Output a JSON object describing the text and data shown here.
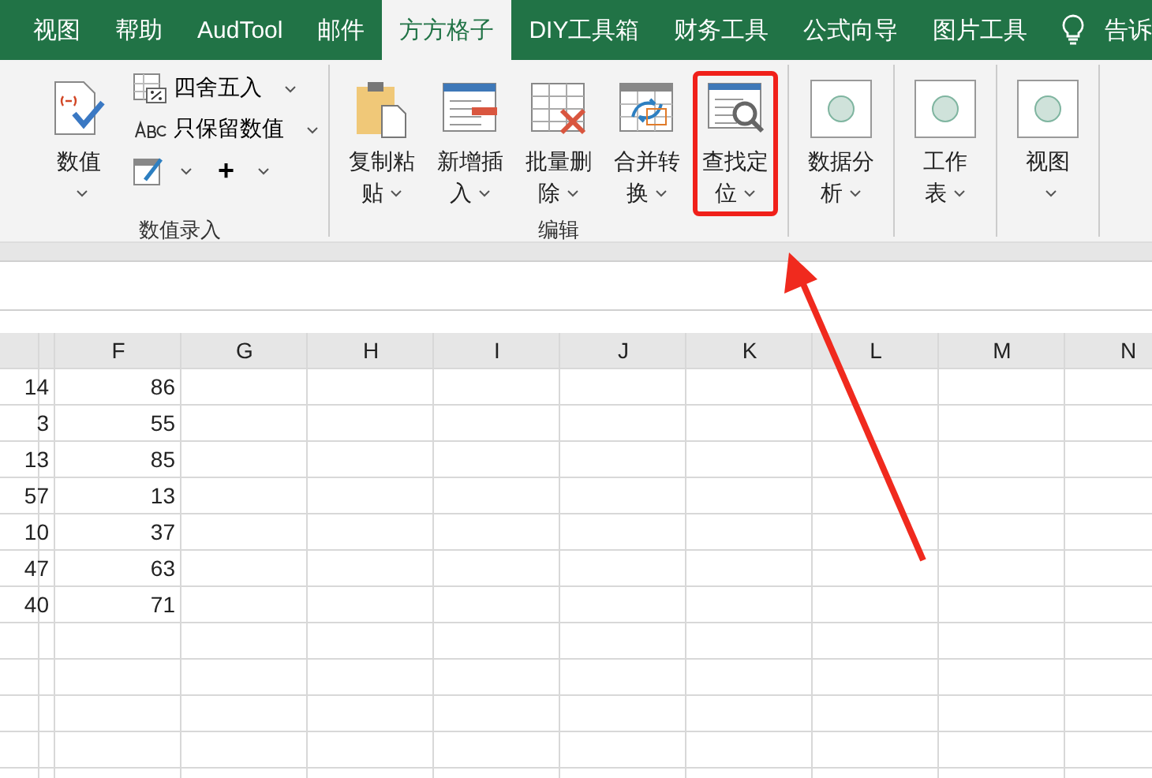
{
  "tabs": [
    {
      "label": "视图",
      "selected": false
    },
    {
      "label": "帮助",
      "selected": false
    },
    {
      "label": "AudTool",
      "selected": false
    },
    {
      "label": "邮件",
      "selected": false
    },
    {
      "label": "方方格子",
      "selected": true
    },
    {
      "label": "DIY工具箱",
      "selected": false
    },
    {
      "label": "财务工具",
      "selected": false
    },
    {
      "label": "公式向导",
      "selected": false
    },
    {
      "label": "图片工具",
      "selected": false
    }
  ],
  "tell_me": "告诉",
  "ribbon": {
    "groups": [
      {
        "label": "数值录入",
        "big_buttons": [
          {
            "kind": "number",
            "lines": [
              "数值"
            ],
            "highlighted": false
          }
        ],
        "small_buttons": [
          {
            "kind": "round",
            "label": "四舍五入"
          },
          {
            "kind": "keep",
            "label": "只保留数值"
          },
          {
            "kind": "tools",
            "label": "+"
          }
        ]
      },
      {
        "label": "编辑",
        "big_buttons": [
          {
            "kind": "paste",
            "lines": [
              "复制粘",
              "贴"
            ],
            "highlighted": false
          },
          {
            "kind": "insert",
            "lines": [
              "新增插",
              "入"
            ],
            "highlighted": false
          },
          {
            "kind": "delete",
            "lines": [
              "批量删",
              "除"
            ],
            "highlighted": false
          },
          {
            "kind": "merge",
            "lines": [
              "合并转",
              "换"
            ],
            "highlighted": false
          },
          {
            "kind": "find",
            "lines": [
              "查找定",
              "位"
            ],
            "highlighted": true
          }
        ]
      },
      {
        "big_buttons": [
          {
            "kind": "circle",
            "lines": [
              "数据分",
              "析"
            ],
            "highlighted": false
          }
        ]
      },
      {
        "big_buttons": [
          {
            "kind": "circle",
            "lines": [
              "工作",
              "表"
            ],
            "highlighted": false
          }
        ]
      },
      {
        "big_buttons": [
          {
            "kind": "circle",
            "lines": [
              "视图"
            ],
            "highlighted": false
          }
        ]
      }
    ]
  },
  "sheet": {
    "columns": [
      "",
      "F",
      "G",
      "H",
      "I",
      "J",
      "K",
      "L",
      "M",
      "N"
    ],
    "rows": [
      [
        "14",
        "86"
      ],
      [
        "3",
        "55"
      ],
      [
        "13",
        "85"
      ],
      [
        "57",
        "13"
      ],
      [
        "10",
        "37"
      ],
      [
        "47",
        "63"
      ],
      [
        "40",
        "71"
      ],
      [],
      [],
      [],
      [],
      []
    ]
  }
}
